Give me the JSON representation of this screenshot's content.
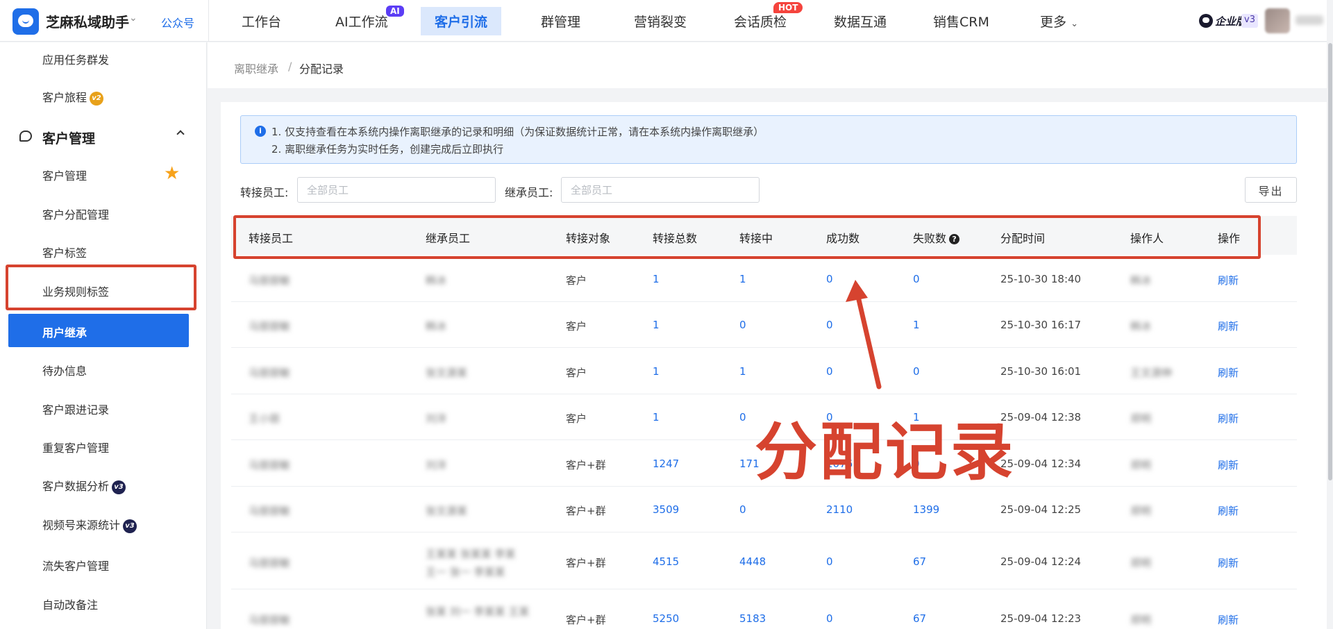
{
  "app": {
    "name": "芝麻私域助手",
    "gzh": "公众号"
  },
  "nav": {
    "items": [
      "工作台",
      "AI工作流",
      "客户引流",
      "群管理",
      "营销裂变",
      "会话质检",
      "数据互通",
      "销售CRM",
      "更多"
    ],
    "active": "客户引流",
    "badge_ai": "AI",
    "badge_hot": "HOT"
  },
  "account": {
    "edition": "企业版",
    "version": "v3"
  },
  "sidebar": {
    "top_items": [
      "应用任务群发",
      "客户旅程"
    ],
    "badge_v2": "v2",
    "badge_v3": "v3",
    "group": "客户管理",
    "items": [
      "客户管理",
      "客户分配管理",
      "客户标签",
      "业务规则标签",
      "用户继承",
      "待办信息",
      "客户跟进记录",
      "重复客户管理",
      "客户数据分析",
      "视频号来源统计",
      "流失客户管理",
      "自动改备注"
    ]
  },
  "breadcrumb": {
    "parent": "离职继承",
    "sep": "/",
    "current": "分配记录"
  },
  "notice": {
    "icon": "i",
    "line1": "1. 仅支持查看在本系统内操作离职继承的记录和明细（为保证数据统计正常，请在本系统内操作离职继承）",
    "line2": "2. 离职继承任务为实时任务，创建完成后立即执行"
  },
  "filters": {
    "transfer_label": "转接员工:",
    "transfer_placeholder": "全部员工",
    "inherit_label": "继承员工:",
    "inherit_placeholder": "全部员工",
    "export": "导出"
  },
  "table": {
    "columns": [
      "转接员工",
      "继承员工",
      "转接对象",
      "转接总数",
      "转接中",
      "成功数",
      "失败数",
      "分配时间",
      "操作人",
      "操作"
    ],
    "help_icon": "?",
    "rows": [
      {
        "from": "马丽丽敏",
        "to": "韩冰",
        "target": "客户",
        "total": "1",
        "pending": "1",
        "success": "0",
        "fail": "0",
        "time": "25-10-30 18:40",
        "operator": "韩冰",
        "action": "刷新"
      },
      {
        "from": "马丽丽敏",
        "to": "韩冰",
        "target": "客户",
        "total": "1",
        "pending": "0",
        "success": "0",
        "fail": "1",
        "time": "25-10-30 16:17",
        "operator": "韩冰",
        "action": "刷新"
      },
      {
        "from": "马丽丽敏",
        "to": "张文源某",
        "target": "客户",
        "total": "1",
        "pending": "1",
        "success": "0",
        "fail": "0",
        "time": "25-10-30 16:01",
        "operator": "王文源伸",
        "action": "刷新"
      },
      {
        "from": "王小丽",
        "to": "刘洋",
        "target": "客户",
        "total": "1",
        "pending": "0",
        "success": "0",
        "fail": "1",
        "time": "25-09-04 12:38",
        "operator": "郑明",
        "action": "刷新"
      },
      {
        "from": "马丽丽敏",
        "to": "刘洋",
        "target": "客户+群",
        "total": "1247",
        "pending": "171",
        "success": "1076",
        "fail": "0",
        "time": "25-09-04 12:34",
        "operator": "郑明",
        "action": "刷新"
      },
      {
        "from": "马丽丽敏",
        "to": "张文源某",
        "target": "客户+群",
        "total": "3509",
        "pending": "0",
        "success": "2110",
        "fail": "1399",
        "time": "25-09-04 12:25",
        "operator": "郑明",
        "action": "刷新"
      },
      {
        "from": "马丽丽敏",
        "to": "王某某 张某某 李某",
        "to2": "王一 张一 李某某",
        "target": "客户+群",
        "total": "4515",
        "pending": "4448",
        "success": "0",
        "fail": "67",
        "time": "25-09-04 12:24",
        "operator": "郑明",
        "action": "刷新"
      },
      {
        "from": "马丽丽敏",
        "to": "张某 刘一 李某某 王某",
        "target": "客户+群",
        "total": "5250",
        "pending": "5183",
        "success": "0",
        "fail": "67",
        "time": "25-09-04 12:23",
        "operator": "郑明",
        "action": "刷新"
      }
    ]
  },
  "annotation": {
    "title": "分配记录"
  }
}
